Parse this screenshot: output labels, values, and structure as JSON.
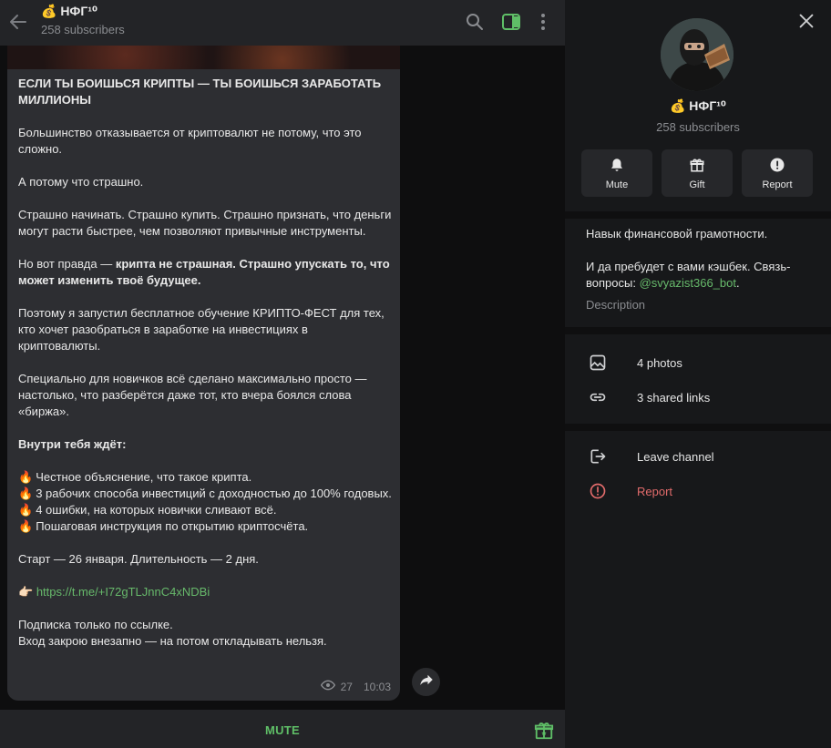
{
  "header": {
    "title": "💰 НФГ¹⁰",
    "subscribers": "258 subscribers"
  },
  "message": {
    "heading": "ЕСЛИ ТЫ БОИШЬСЯ КРИПТЫ — ТЫ БОИШЬСЯ ЗАРАБОТАТЬ МИЛЛИОНЫ",
    "p1": "Большинство отказывается от криптовалют не потому, что это сложно.",
    "p2": "А потому что страшно.",
    "p3": "Страшно начинать. Страшно купить. Страшно признать, что деньги могут расти быстрее, чем позволяют привычные инструменты.",
    "p4_plain": "Но вот правда — ",
    "p4_bold": "крипта не страшная. Страшно упускать то, что может изменить твоё будущее.",
    "p5": "Поэтому я запустил бесплатное обучение КРИПТО-ФЕСТ для тех, кто хочет разобраться в заработке на инвестициях в криптовалюты.",
    "p6": "Специально для новичков всё сделано максимально просто — настолько, что разберётся даже тот, кто вчера боялся слова «биржа».",
    "list_heading": "Внутри тебя ждёт:",
    "list": [
      "Честное объяснение, что такое крипта.",
      "3 рабочих способа инвестиций с доходностью до 100% годовых.",
      "4 ошибки, на которых новички сливают всё.",
      "Пошаговая инструкция по открытию криптосчёта."
    ],
    "start": "Старт — 26 января. Длительность — 2 дня.",
    "link_emoji": "👉🏻",
    "link": "https://t.me/+I72gTLJnnC4xNDBi",
    "closing1": "Подписка только по ссылке.",
    "closing2": "Вход закрою внезапно — на потом откладывать нельзя.",
    "views": "27",
    "time": "10:03"
  },
  "footer": {
    "mute_label": "MUTE"
  },
  "panel": {
    "title": "💰 НФГ¹⁰",
    "subscribers": "258 subscribers",
    "actions": {
      "mute": "Mute",
      "gift": "Gift",
      "report": "Report"
    },
    "description_line1": "Навык финансовой грамотности.",
    "description_line2": "И да пребудет с вами кэшбек. Связь-вопросы: ",
    "description_link": "@svyazist366_bot",
    "description_end": ".",
    "description_caption": "Description",
    "photos": "4 photos",
    "links": "3 shared links",
    "leave": "Leave channel",
    "report": "Report"
  },
  "colors": {
    "accent": "#5fbf67",
    "danger": "#e26b6b",
    "bubble": "#2d2e32"
  }
}
